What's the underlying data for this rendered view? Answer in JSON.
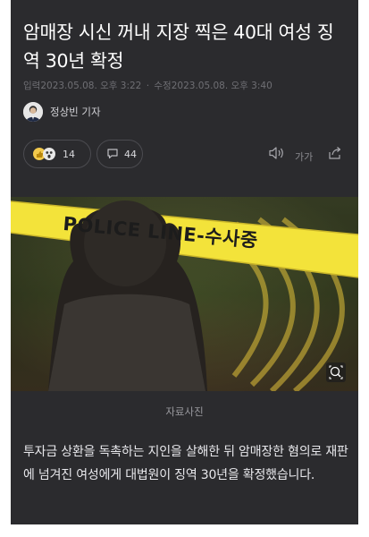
{
  "article": {
    "title": "암매장 시신 꺼내 지장 찍은 40대 여성 징역 30년 확정",
    "published_label": "입력",
    "published_at": "2023.05.08. 오후 3:22",
    "separator": "·",
    "modified_label": "수정",
    "modified_at": "2023.05.08. 오후 3:40",
    "author": "정상빈 기자",
    "reactions_count": "14",
    "comments_count": "44",
    "font_tool_label": "가가",
    "photo_tape_text": "POLICE LINE-수사중",
    "photo_caption": "자료사진",
    "body": "투자금 상환을 독촉하는 지인을 살해한 뒤 암매장한 혐의로 재판에 넘겨진 여성에게 대법원이 징역 30년을 확정했습니다."
  },
  "icons": {
    "reaction_icons": [
      "thumbs-up-emoji",
      "surprised-emoji"
    ],
    "comment": "speech-bubble-icon",
    "speaker": "speaker-icon",
    "share": "share-icon",
    "zoom": "zoom-icon"
  },
  "colors": {
    "background": "#2b2b2e",
    "tape": "#f3e33a",
    "title": "#ffffff",
    "meta": "#6f6f74"
  }
}
